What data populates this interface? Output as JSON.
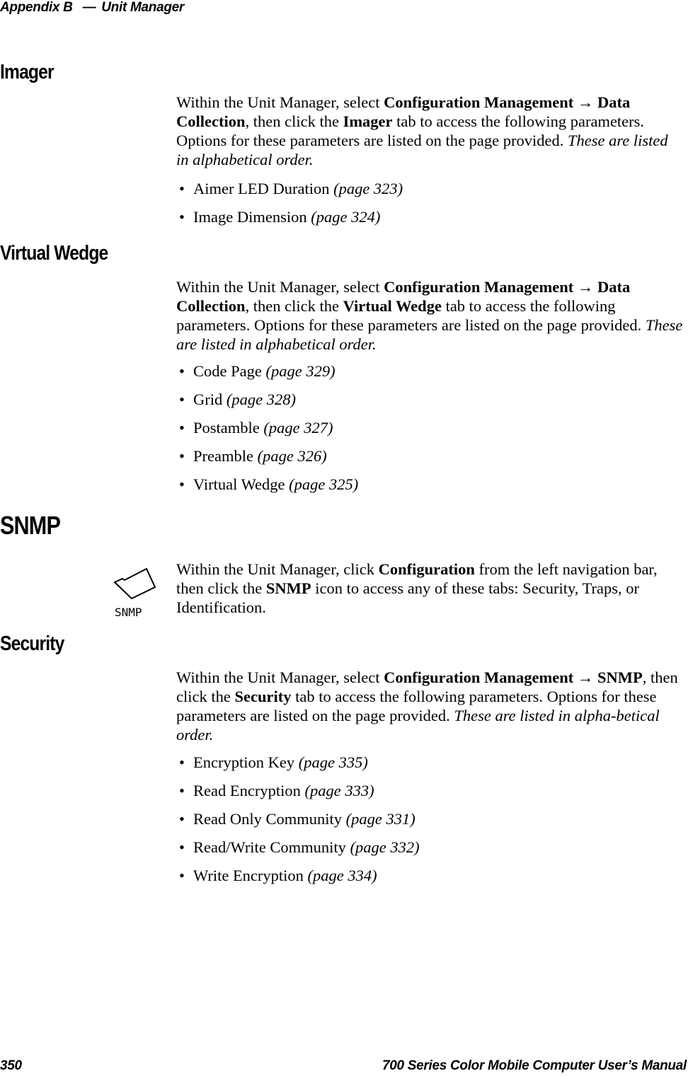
{
  "header": {
    "appendix": "Appendix B",
    "dash": "—",
    "title": "Unit Manager"
  },
  "sections": {
    "imager": {
      "heading": "Imager",
      "p1": "Within the Unit Manager, select ",
      "b1": "Configuration Management",
      "arrow": " → ",
      "b2": "Data Collection",
      "p2": ", then click the ",
      "b3": "Imager",
      "p3": " tab to access the following parameters. Options for these parameters are listed on the page provided. ",
      "i1": "These are listed in alphabetical order.",
      "items": [
        {
          "label": "Aimer LED Duration ",
          "page": "(page 323)"
        },
        {
          "label": "Image Dimension ",
          "page": "(page 324)"
        }
      ]
    },
    "virtual_wedge": {
      "heading": "Virtual Wedge",
      "p1": "Within the Unit Manager, select ",
      "b1": "Configuration Management",
      "arrow": " → ",
      "b2": "Data Collection",
      "p2": ", then click the ",
      "b3": "Virtual Wedge",
      "p3": " tab to access the following parameters. Options for these parameters are listed on the page provided. ",
      "i1": "These are listed in alphabetical order.",
      "items": [
        {
          "label": "Code Page ",
          "page": "(page 329)"
        },
        {
          "label": "Grid ",
          "page": "(page 328)"
        },
        {
          "label": "Postamble ",
          "page": "(page 327)"
        },
        {
          "label": "Preamble ",
          "page": "(page 326)"
        },
        {
          "label": "Virtual Wedge ",
          "page": "(page 325)"
        }
      ]
    },
    "snmp": {
      "heading": "SNMP",
      "icon_label": "SNMP",
      "p1": "Within the Unit Manager, click ",
      "b1": "Configuration",
      "p2": " from the left navigation bar, then click the ",
      "b2": "SNMP",
      "p3": " icon to access any of these tabs: Security, Traps, or Identification."
    },
    "security": {
      "heading": "Security",
      "p1": "Within the Unit Manager, select ",
      "b1": "Configuration Management",
      "arrow": " → ",
      "b2": "SNMP",
      "p2": ", then click the ",
      "b3": "Security",
      "p3": " tab to access the following parameters. Options for these parameters are listed on the page provided. ",
      "i1": "These are listed in alpha-betical order.",
      "items": [
        {
          "label": "Encryption Key ",
          "page": "(page 335)"
        },
        {
          "label": "Read Encryption ",
          "page": "(page 333)"
        },
        {
          "label": "Read Only Community ",
          "page": "(page 331)"
        },
        {
          "label": "Read/Write Community ",
          "page": "(page 332)"
        },
        {
          "label": "Write Encryption ",
          "page": "(page 334)"
        }
      ]
    }
  },
  "footer": {
    "page_number": "350",
    "manual_title": "700 Series Color Mobile Computer User’s Manual"
  },
  "bullet": "•"
}
